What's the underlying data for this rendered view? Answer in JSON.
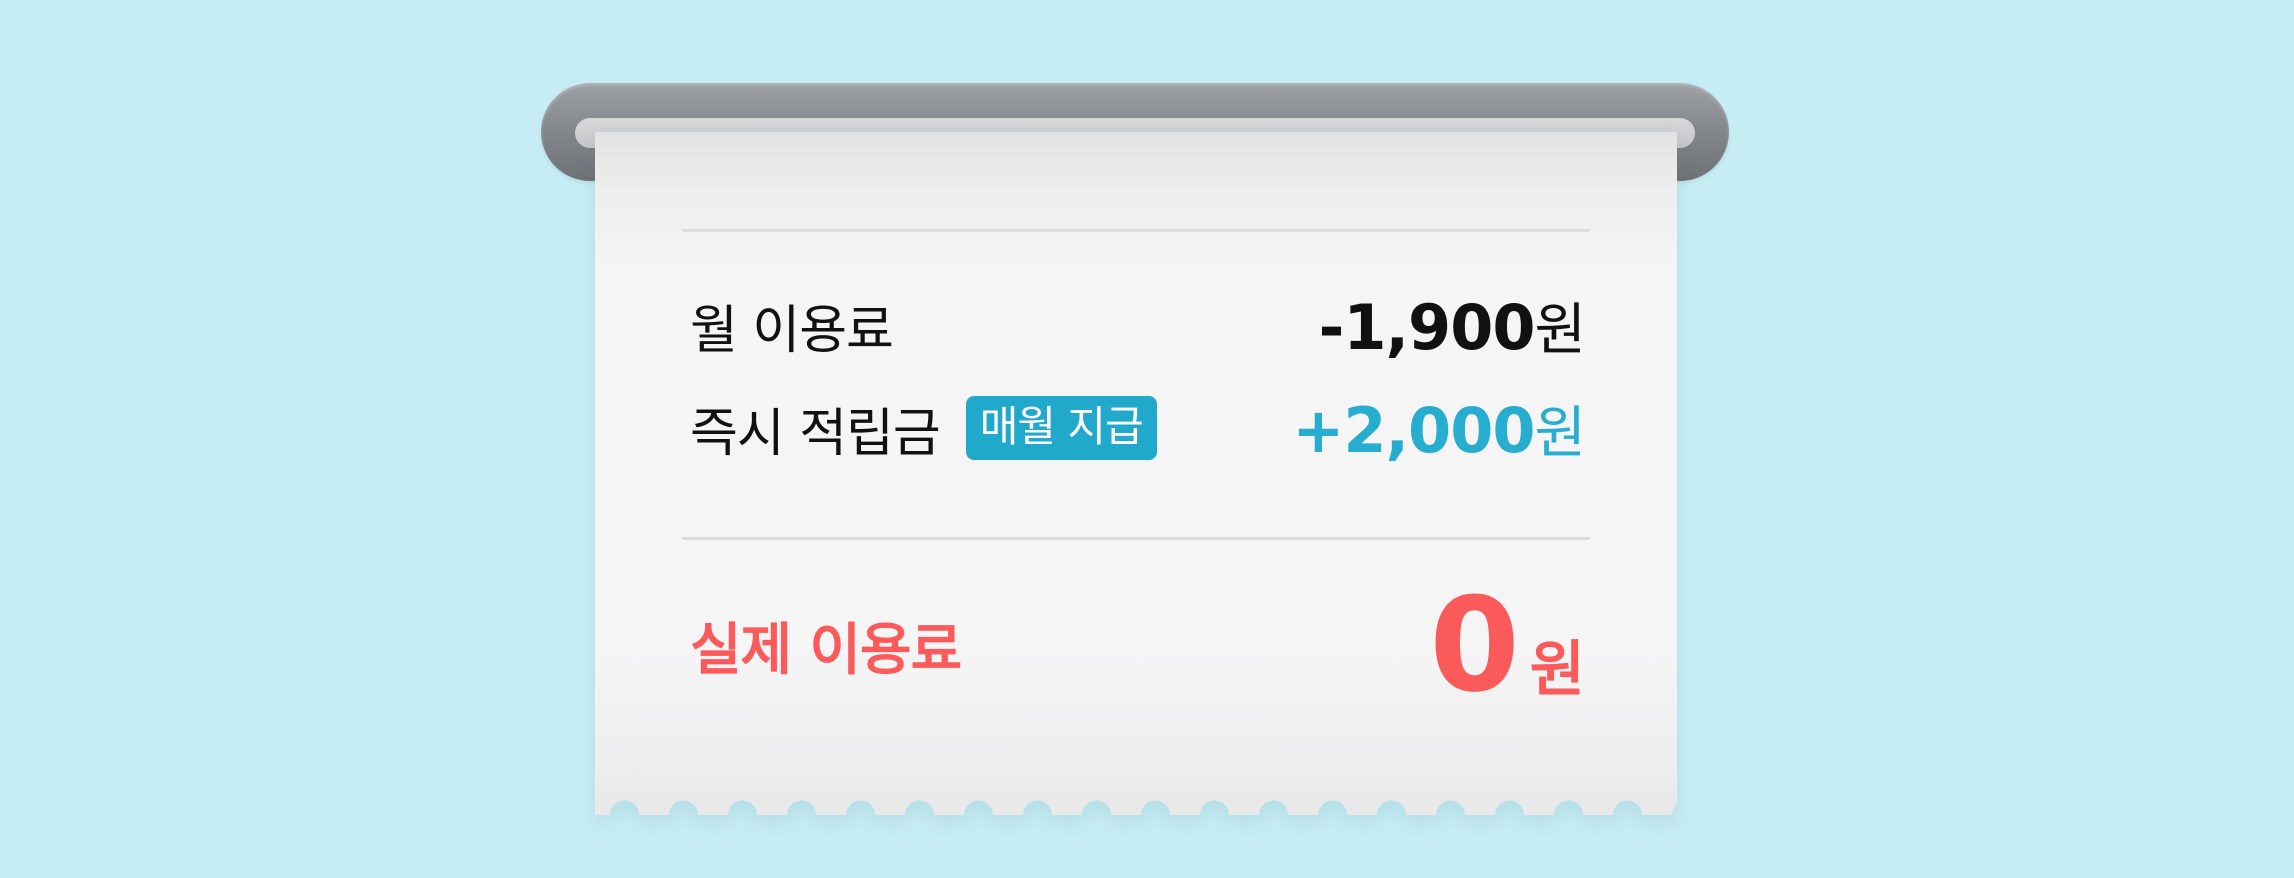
{
  "receipt": {
    "monthly_fee": {
      "label": "월 이용료",
      "amount": "-1,900",
      "unit": "원"
    },
    "instant_reward": {
      "label": "즉시 적립금",
      "badge": "매월 지급",
      "amount": "+2,000",
      "unit": "원"
    },
    "actual_fee": {
      "label": "실제 이용료",
      "amount": "0",
      "unit": "원"
    }
  },
  "colors": {
    "background": "#c6edf4",
    "accent_blue": "#26add0",
    "accent_red": "#fb5a5a",
    "text": "#111111"
  }
}
